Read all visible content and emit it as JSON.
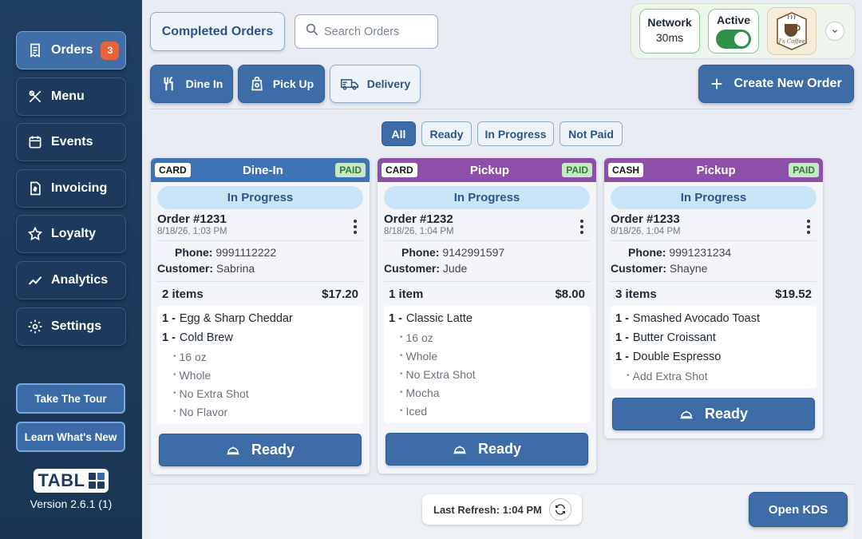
{
  "sidebar": {
    "items": [
      {
        "label": "Orders",
        "badge": "3",
        "icon": "receipt-icon"
      },
      {
        "label": "Menu",
        "icon": "utensils-icon"
      },
      {
        "label": "Events",
        "icon": "calendar-icon"
      },
      {
        "label": "Invoicing",
        "icon": "invoice-icon"
      },
      {
        "label": "Loyalty",
        "icon": "star-icon"
      },
      {
        "label": "Analytics",
        "icon": "chart-line-icon"
      },
      {
        "label": "Settings",
        "icon": "gear-icon"
      }
    ],
    "tour_label": "Take The Tour",
    "whats_new_label": "Learn What's New",
    "logo_text": "TABL",
    "version": "Version 2.6.1 (1)"
  },
  "header": {
    "completed_orders_label": "Completed Orders",
    "search_placeholder": "Search Orders",
    "network_label": "Network",
    "network_value": "30ms",
    "active_label": "Active",
    "avatar_text": "J's Coffee",
    "order_types": [
      {
        "label": "Dine In",
        "icon": "fork-knife-icon",
        "selected": true
      },
      {
        "label": "Pick Up",
        "icon": "bag-icon",
        "selected": true
      },
      {
        "label": "Delivery",
        "icon": "truck-icon",
        "selected": false
      }
    ],
    "create_order_label": "Create New Order"
  },
  "filters": [
    {
      "label": "All",
      "selected": true
    },
    {
      "label": "Ready",
      "selected": false
    },
    {
      "label": "In Progress",
      "selected": false
    },
    {
      "label": "Not Paid",
      "selected": false
    }
  ],
  "orders": [
    {
      "payment": "CARD",
      "type": "Dine-In",
      "paid": "PAID",
      "header_color": "#3e73b5",
      "status": "In Progress",
      "number": "Order #1231",
      "date": "8/18/26, 1:03 PM",
      "phone_label": "Phone:",
      "phone": "9991112222",
      "customer_label": "Customer:",
      "customer": "Sabrina",
      "count": "2 items",
      "total": "$17.20",
      "items": [
        {
          "qty": "1 -",
          "name": "Egg & Sharp Cheddar",
          "mods": []
        },
        {
          "qty": "1 -",
          "name": "Cold Brew",
          "mods": [
            "16 oz",
            "Whole",
            "No Extra Shot",
            "No Flavor"
          ]
        }
      ],
      "action": "Ready"
    },
    {
      "payment": "CARD",
      "type": "Pickup",
      "paid": "PAID",
      "header_color": "#8e4fa9",
      "status": "In Progress",
      "number": "Order #1232",
      "date": "8/18/26, 1:04 PM",
      "phone_label": "Phone:",
      "phone": "9142991597",
      "customer_label": "Customer:",
      "customer": "Jude",
      "count": "1 item",
      "total": "$8.00",
      "items": [
        {
          "qty": "1 -",
          "name": "Classic Latte",
          "mods": [
            "16 oz",
            "Whole",
            "No Extra Shot",
            "Mocha",
            "Iced"
          ]
        }
      ],
      "action": "Ready"
    },
    {
      "payment": "CASH",
      "type": "Pickup",
      "paid": "PAID",
      "header_color": "#8e4fa9",
      "status": "In Progress",
      "number": "Order #1233",
      "date": "8/18/26, 1:04 PM",
      "phone_label": "Phone:",
      "phone": "9991231234",
      "customer_label": "Customer:",
      "customer": "Shayne",
      "count": "3 items",
      "total": "$19.52",
      "items": [
        {
          "qty": "1 -",
          "name": "Smashed Avocado Toast",
          "mods": []
        },
        {
          "qty": "1 -",
          "name": "Butter Croissant",
          "mods": []
        },
        {
          "qty": "1 -",
          "name": "Double Espresso",
          "mods": [
            "Add Extra Shot"
          ]
        }
      ],
      "action": "Ready"
    }
  ],
  "footer": {
    "last_refresh": "Last Refresh: 1:04 PM",
    "open_kds_label": "Open KDS"
  }
}
